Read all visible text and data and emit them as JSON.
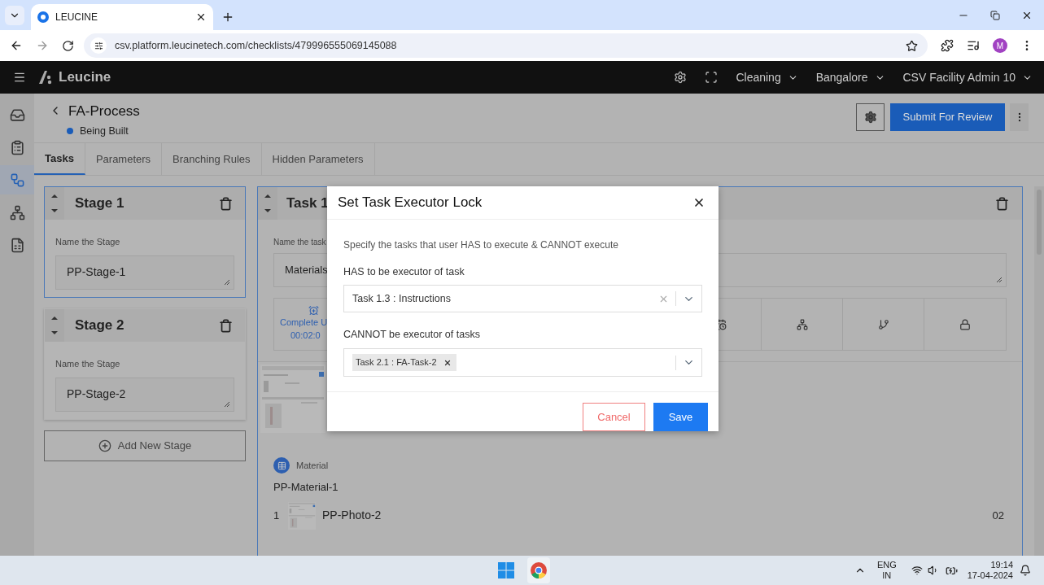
{
  "browser": {
    "tab_title": "LEUCINE",
    "url": "csv.platform.leucinetech.com/checklists/479996555069145088",
    "profile_initial": "M"
  },
  "header": {
    "brand": "Leucine",
    "menus": [
      {
        "label": "Cleaning"
      },
      {
        "label": "Bangalore"
      },
      {
        "label": "CSV Facility Admin 10"
      }
    ]
  },
  "nav": [
    {
      "kind": "inbox",
      "selected": false
    },
    {
      "kind": "checklist",
      "selected": false
    },
    {
      "kind": "flow",
      "selected": true
    },
    {
      "kind": "hierarchy",
      "selected": false
    },
    {
      "kind": "report",
      "selected": false
    }
  ],
  "process": {
    "title": "FA-Process",
    "status": "Being Built",
    "submit": "Submit For Review"
  },
  "tabs": [
    {
      "label": "Tasks",
      "selected": true
    },
    {
      "label": "Parameters",
      "selected": false
    },
    {
      "label": "Branching Rules",
      "selected": false
    },
    {
      "label": "Hidden Parameters",
      "selected": false
    }
  ],
  "stages": [
    {
      "title": "Stage 1",
      "field_label": "Name the Stage",
      "value": "PP-Stage-1",
      "selected": true
    },
    {
      "title": "Stage 2",
      "field_label": "Name the Stage",
      "value": "PP-Stage-2",
      "selected": false
    }
  ],
  "add_stage": "Add New Stage",
  "task": {
    "title": "Task 1",
    "field_label": "Name the task",
    "value": "Materials",
    "timer_label": "Complete U",
    "timer_time": "00:02:0",
    "actions": [
      {
        "kind": "schedule"
      },
      {
        "kind": "hierarchy"
      },
      {
        "kind": "branch"
      },
      {
        "kind": "lock"
      }
    ],
    "material": {
      "type_label": "Material",
      "name": "PP-Material-1",
      "items": [
        {
          "index": "1",
          "name": "PP-Photo-2",
          "quantity": "02"
        }
      ]
    }
  },
  "dialog": {
    "title": "Set Task Executor Lock",
    "description": "Specify the tasks that user HAS to execute & CANNOT execute",
    "has_label": "HAS to be executor of task",
    "has_value": "Task 1.3 : Instructions",
    "cannot_label": "CANNOT be executor of tasks",
    "cannot_tags": [
      "Task 2.1 : FA-Task-2"
    ],
    "cancel": "Cancel",
    "save": "Save"
  },
  "taskbar": {
    "language": "ENG",
    "region": "IN",
    "time": "19:14",
    "date": "17-04-2024"
  }
}
